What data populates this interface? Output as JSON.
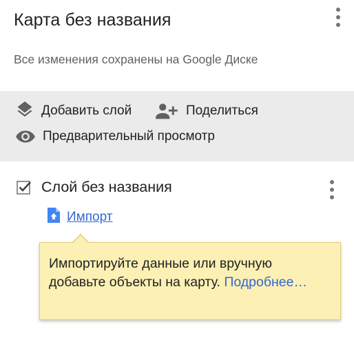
{
  "header": {
    "title": "Карта без названия",
    "save_status": "Все изменения сохранены на Google Диске",
    "menu_icon": "more-vert-icon"
  },
  "toolbar": {
    "add_layer_label": "Добавить слой",
    "share_label": "Поделиться",
    "preview_label": "Предварительный просмотр",
    "icons": [
      "layers-icon",
      "person-add-icon",
      "eye-icon"
    ]
  },
  "layer": {
    "name": "Слой без названия",
    "checked": true,
    "import_label": "Импорт",
    "import_icon": "file-upload-icon"
  },
  "tooltip": {
    "text": "Импортируйте данные или вручную добавьте объекты на карту.",
    "link": "Подробнее…"
  },
  "colors": {
    "toolbar_bg": "#ebebeb",
    "link": "#3367d6",
    "tooltip_bg": "#fcf0b4",
    "tooltip_border": "#e2cc79"
  }
}
